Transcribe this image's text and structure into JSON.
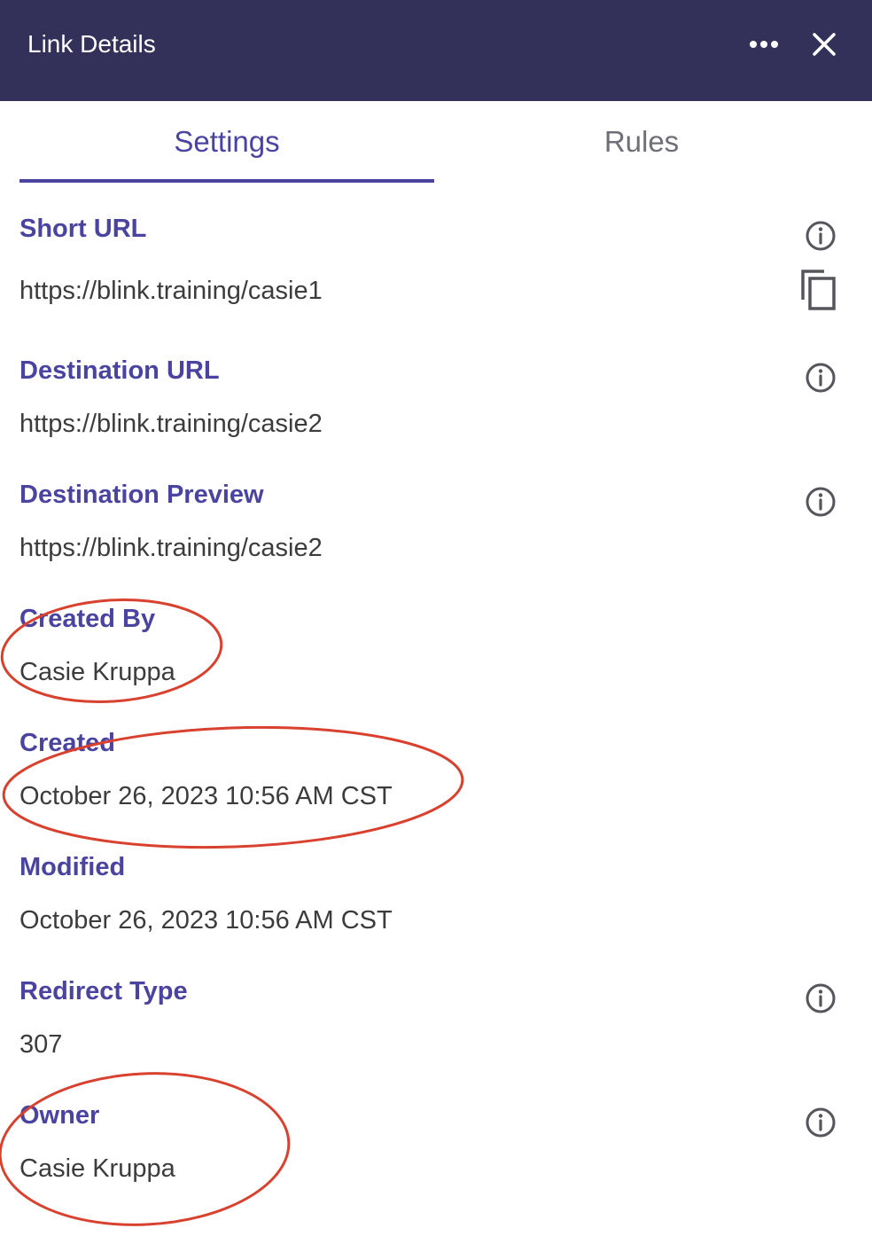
{
  "header": {
    "title": "Link Details",
    "bg_color": "#33305a",
    "more_icon": "more-horizontal-icon",
    "close_icon": "close-icon"
  },
  "tabs": [
    {
      "label": "Settings",
      "active": true
    },
    {
      "label": "Rules",
      "active": false
    }
  ],
  "accent_color": "#4a44a0",
  "fields": {
    "short_url": {
      "label": "Short URL",
      "value": "https://blink.training/casie1"
    },
    "destination_url": {
      "label": "Destination URL",
      "value": "https://blink.training/casie2"
    },
    "destination_preview": {
      "label": "Destination Preview",
      "value": "https://blink.training/casie2"
    },
    "created_by": {
      "label": "Created By",
      "value": "Casie Kruppa"
    },
    "created": {
      "label": "Created",
      "value": "October 26, 2023 10:56 AM CST"
    },
    "modified": {
      "label": "Modified",
      "value": "October 26, 2023 10:56 AM CST"
    },
    "redirect_type": {
      "label": "Redirect Type",
      "value": "307"
    },
    "owner": {
      "label": "Owner",
      "value": "Casie Kruppa"
    }
  },
  "annotation_color": "#d9412f"
}
